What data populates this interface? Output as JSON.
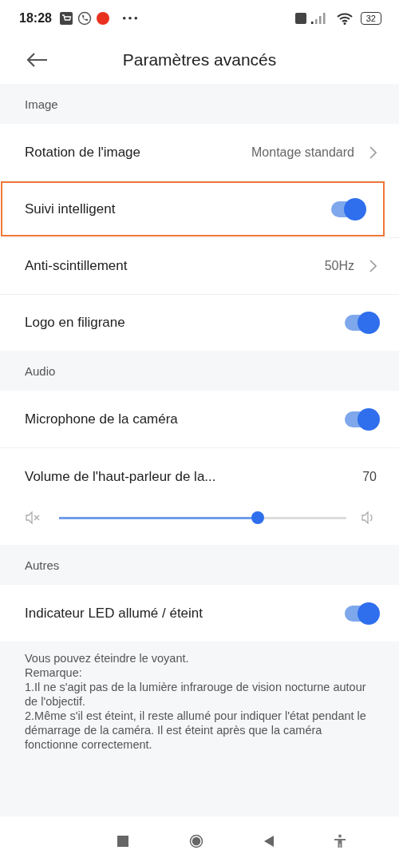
{
  "status_bar": {
    "time": "18:28",
    "battery": "32"
  },
  "header": {
    "title": "Paramètres avancés"
  },
  "sections": [
    {
      "title": "Image",
      "items": [
        {
          "kind": "nav",
          "label": "Rotation de l'image",
          "value": "Montage standard",
          "highlighted": false
        },
        {
          "kind": "toggle",
          "label": "Suivi intelligent",
          "on": true,
          "highlighted": true
        },
        {
          "kind": "nav",
          "label": "Anti-scintillement",
          "value": "50Hz",
          "highlighted": false
        },
        {
          "kind": "toggle",
          "label": "Logo en filigrane",
          "on": true,
          "highlighted": false
        }
      ]
    },
    {
      "title": "Audio",
      "items": [
        {
          "kind": "toggle",
          "label": "Microphone de la caméra",
          "on": true,
          "highlighted": false
        },
        {
          "kind": "slider",
          "label": "Volume de l'haut-parleur de la...",
          "reading": "70",
          "level": 0.7,
          "highlighted": false
        }
      ]
    },
    {
      "title": "Autres",
      "items": [
        {
          "kind": "toggle",
          "label": "Indicateur LED allumé / éteint",
          "on": true,
          "highlighted": false
        }
      ]
    }
  ],
  "note": [
    "Vous pouvez éteindre le voyant.",
    "Remarque:",
    "1.Il ne s'agit pas de la lumière infrarouge de vision nocturne autour de l'objectif.",
    "2.Même s'il est éteint, il reste allumé pour indiquer l'état pendant le démarrage de la caméra. Il est éteint après que la caméra fonctionne correctement."
  ]
}
